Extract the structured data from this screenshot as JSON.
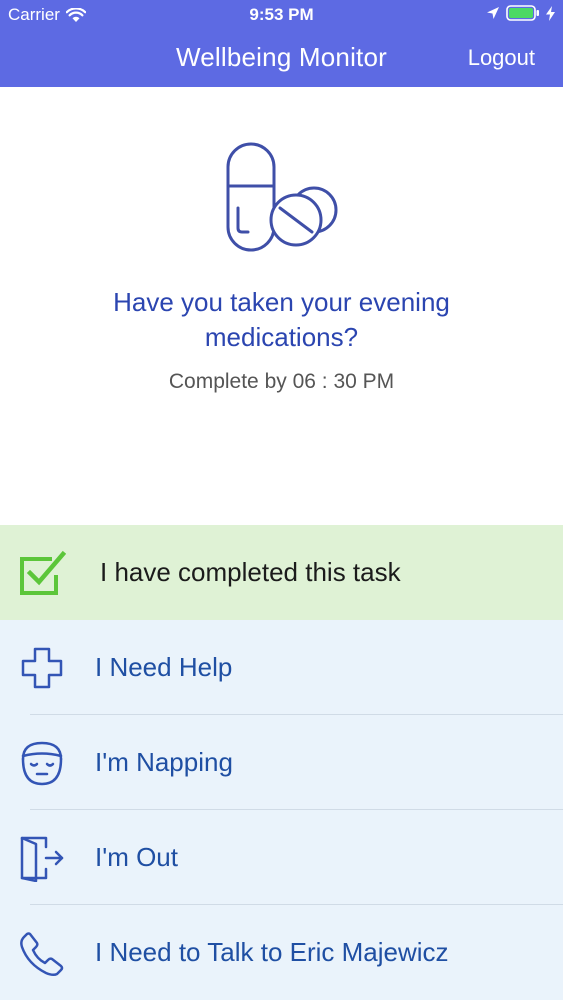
{
  "status_bar": {
    "carrier": "Carrier",
    "time": "9:53 PM"
  },
  "nav": {
    "title": "Wellbeing Monitor",
    "logout_label": "Logout"
  },
  "prompt": {
    "icon": "pills-icon",
    "question_line1": "Have you taken your evening",
    "question_line2": "medications?",
    "due_text": "Complete by 06 : 30 PM"
  },
  "actions": [
    {
      "icon": "checkbox-checked-icon",
      "label": "I have completed this task"
    },
    {
      "icon": "plus-cross-icon",
      "label": "I Need Help"
    },
    {
      "icon": "sleeping-face-icon",
      "label": "I'm Napping"
    },
    {
      "icon": "door-exit-icon",
      "label": "I'm Out"
    },
    {
      "icon": "phone-icon",
      "label": "I Need to Talk to Eric Majewicz"
    }
  ],
  "colors": {
    "header_bg": "#5d6ae3",
    "accent_blue": "#2b45b0",
    "complete_bg": "#dff2d5",
    "complete_check": "#5cc63a",
    "list_bg": "#eaf3fb"
  }
}
